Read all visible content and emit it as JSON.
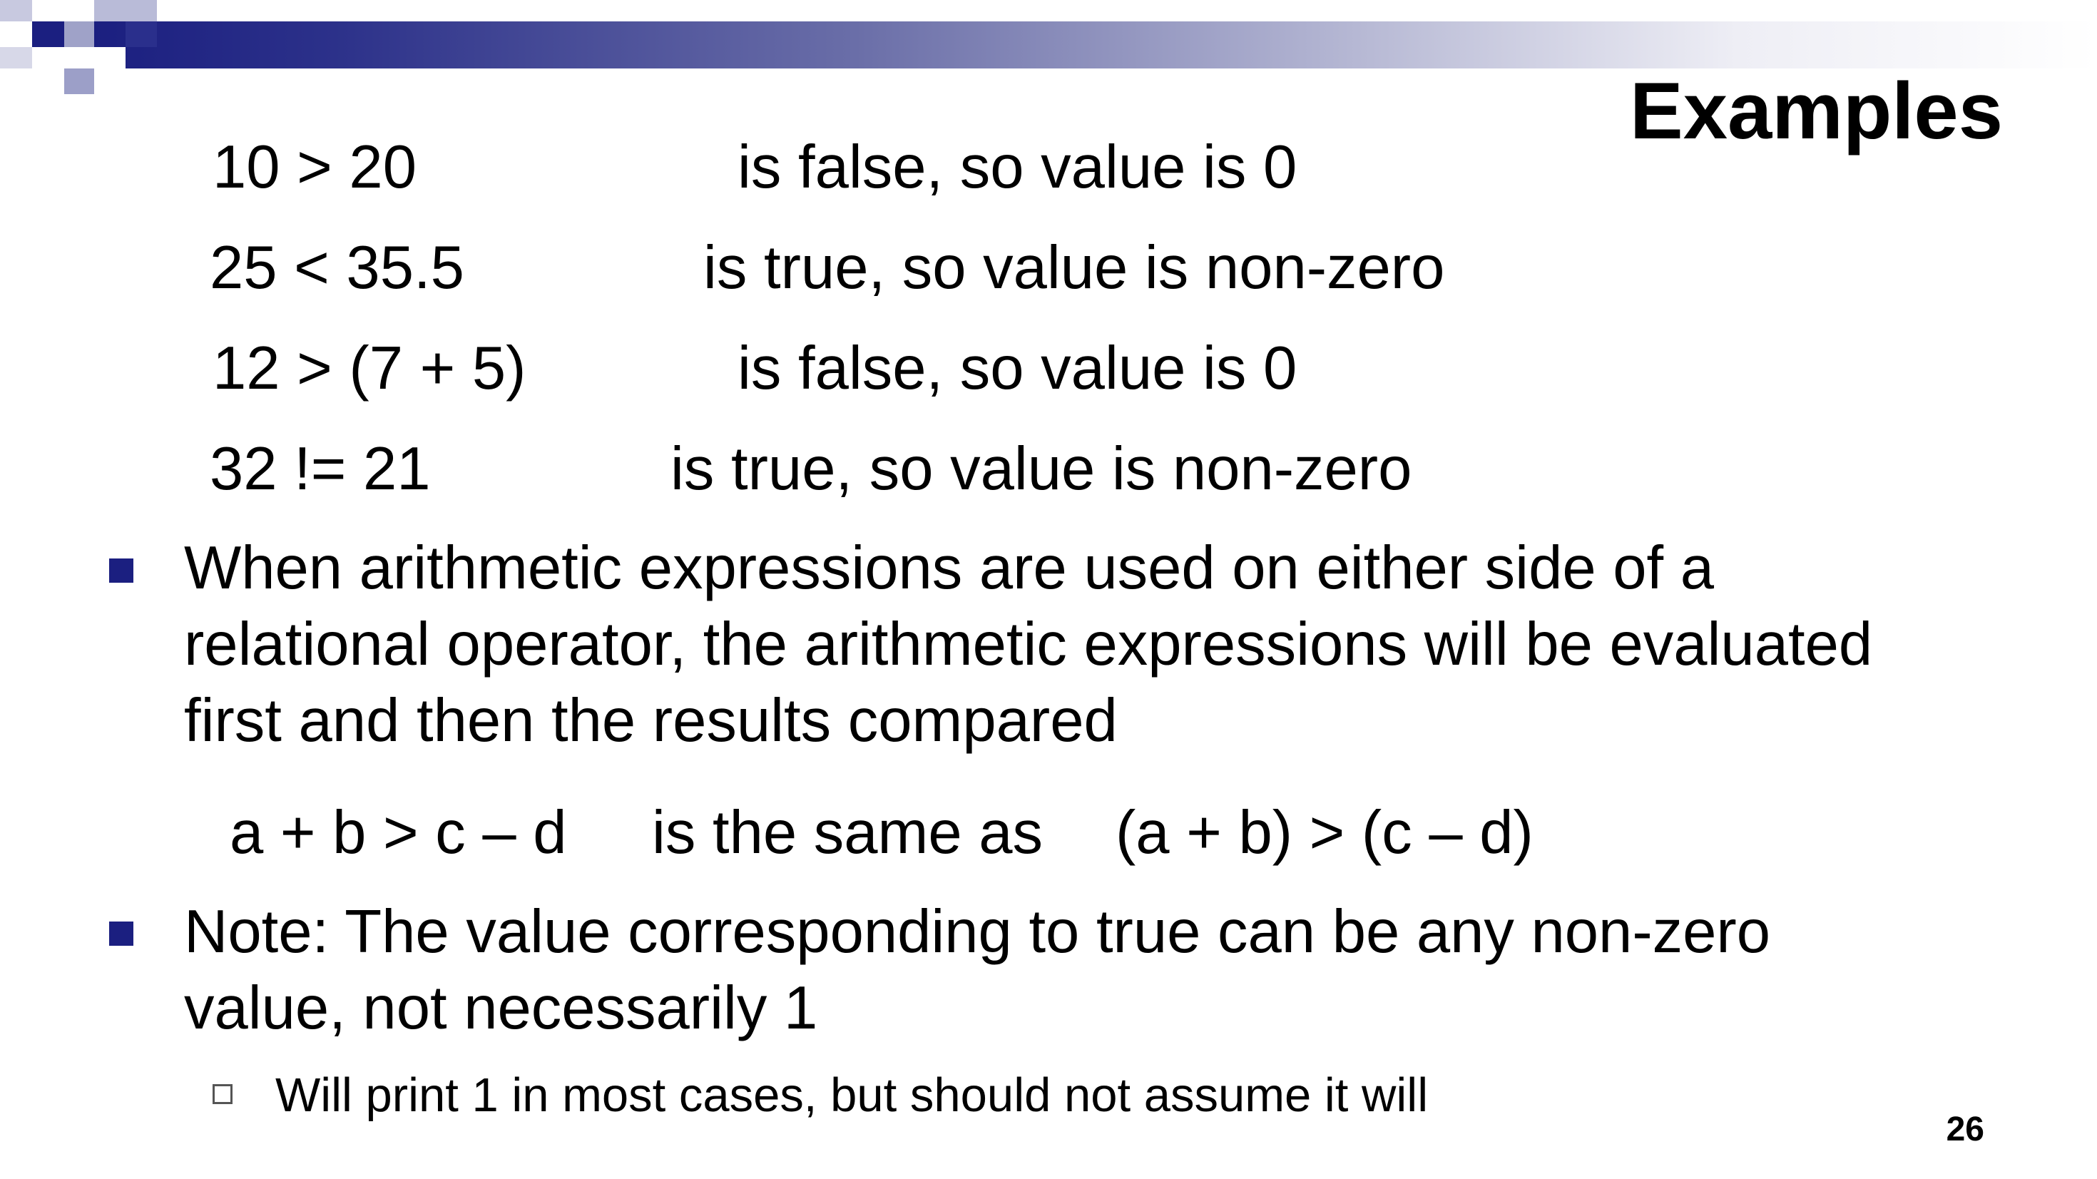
{
  "title": "Examples",
  "examples": [
    {
      "expr": "10 > 20",
      "result": "is false, so value is 0"
    },
    {
      "expr": "25 < 35.5",
      "result": "is true, so value is non-zero"
    },
    {
      "expr": "12 > (7 + 5)",
      "result": "is false, so value is 0"
    },
    {
      "expr": "32 != 21",
      "result": "is true, so value is non-zero"
    }
  ],
  "bullets": [
    {
      "lines": [
        "When arithmetic expressions are used on either side of a",
        "relational operator, the arithmetic expressions will be evaluated",
        "first and then the results compared"
      ]
    },
    {
      "lines": [
        "Note: The value corresponding to true can be any non-zero",
        "value, not necessarily 1"
      ]
    }
  ],
  "equivalence": {
    "left": "a + b > c – d",
    "middle": "is the same as",
    "right": "(a + b) > (c – d)"
  },
  "sub_bullet": "Will print 1 in most cases, but should not assume it will",
  "page_number": "26",
  "colors": {
    "accent": "#1b1f80",
    "text": "#000000"
  }
}
